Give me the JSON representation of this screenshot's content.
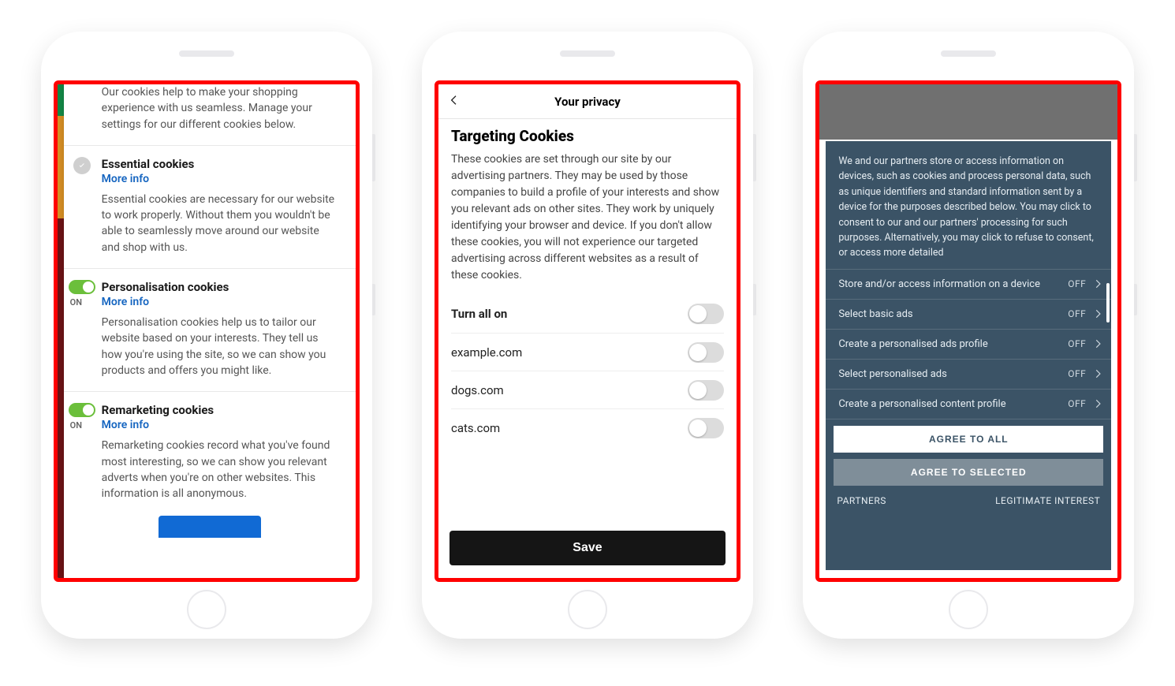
{
  "phone1": {
    "intro": "Our cookies help to make your shopping experience with us seamless. Manage your settings for our different cookies below.",
    "more_info_label": "More info",
    "on_label": "ON",
    "essential": {
      "title": "Essential cookies",
      "desc": "Essential cookies are necessary for our website to work properly. Without them you wouldn't be able to seamlessly move around our website and shop with us."
    },
    "personalisation": {
      "title": "Personalisation cookies",
      "desc": "Personalisation cookies help us to tailor our website based on your interests. They tell us how you're using the site, so we can show you products and offers you might like."
    },
    "remarketing": {
      "title": "Remarketing cookies",
      "desc": "Remarketing cookies record what you've found most interesting, so we can show you relevant adverts when you're on other websites. This information is all anonymous."
    }
  },
  "phone2": {
    "header_title": "Your privacy",
    "heading": "Targeting Cookies",
    "explain": "These cookies are set through our site by our advertising partners. They may be used by those companies to build a profile of your interests and show you relevant ads on other sites. They work by uniquely identifying your browser and device. If you don't allow these cookies, you will not experience our targeted advertising across different websites as a result of these cookies.",
    "turn_all": "Turn all on",
    "rows": [
      "example.com",
      "dogs.com",
      "cats.com"
    ],
    "save": "Save"
  },
  "phone3": {
    "intro": "We and our partners store or access information on devices, such as cookies and process personal data, such as unique identifiers and standard information sent by a device for the purposes described below. You may click to consent to our and our partners' processing for such purposes. Alternatively, you may click to refuse to consent, or access more detailed",
    "off_label": "OFF",
    "rows": [
      "Store and/or access information on a device",
      "Select basic ads",
      "Create a personalised ads profile",
      "Select personalised ads",
      "Create a personalised content profile"
    ],
    "agree_all": "AGREE TO ALL",
    "agree_selected": "AGREE TO SELECTED",
    "partners": "PARTNERS",
    "legitimate": "LEGITIMATE INTEREST"
  }
}
